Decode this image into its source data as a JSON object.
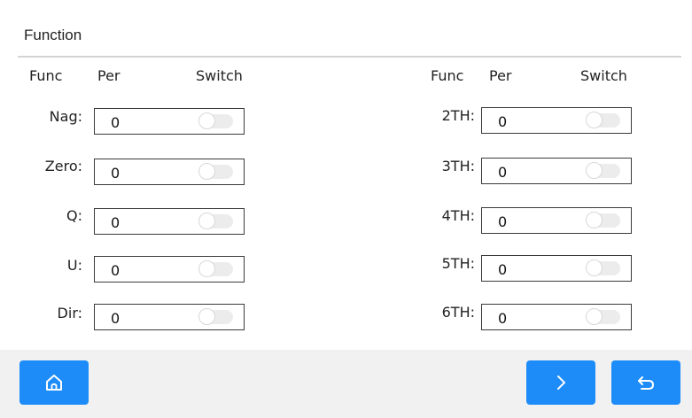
{
  "panel": {
    "title": "Function"
  },
  "left_column": {
    "headers": {
      "func": "Func",
      "per": "Per",
      "switch": "Switch"
    },
    "rows": [
      {
        "label": "Nag:",
        "value": "0",
        "switch_on": false
      },
      {
        "label": "Zero:",
        "value": "0",
        "switch_on": false
      },
      {
        "label": "Q:",
        "value": "0",
        "switch_on": false
      },
      {
        "label": "U:",
        "value": "0",
        "switch_on": false
      },
      {
        "label": "Dir:",
        "value": "0",
        "switch_on": false
      }
    ]
  },
  "right_column": {
    "headers": {
      "func": "Func",
      "per": "Per",
      "switch": "Switch"
    },
    "rows": [
      {
        "label": "2TH:",
        "value": "0",
        "switch_on": false
      },
      {
        "label": "3TH:",
        "value": "0",
        "switch_on": false
      },
      {
        "label": "4TH:",
        "value": "0",
        "switch_on": false
      },
      {
        "label": "5TH:",
        "value": "0",
        "switch_on": false
      },
      {
        "label": "6TH:",
        "value": "0",
        "switch_on": false
      }
    ]
  },
  "footer": {
    "home_icon": "home-icon",
    "next_icon": "chevron-right-icon",
    "back_icon": "return-arrow-icon"
  },
  "colors": {
    "accent": "#1d8cf8",
    "panel_background": "#ffffff",
    "screen_background": "#f1f1f1",
    "toggle_off": "#ececec"
  }
}
